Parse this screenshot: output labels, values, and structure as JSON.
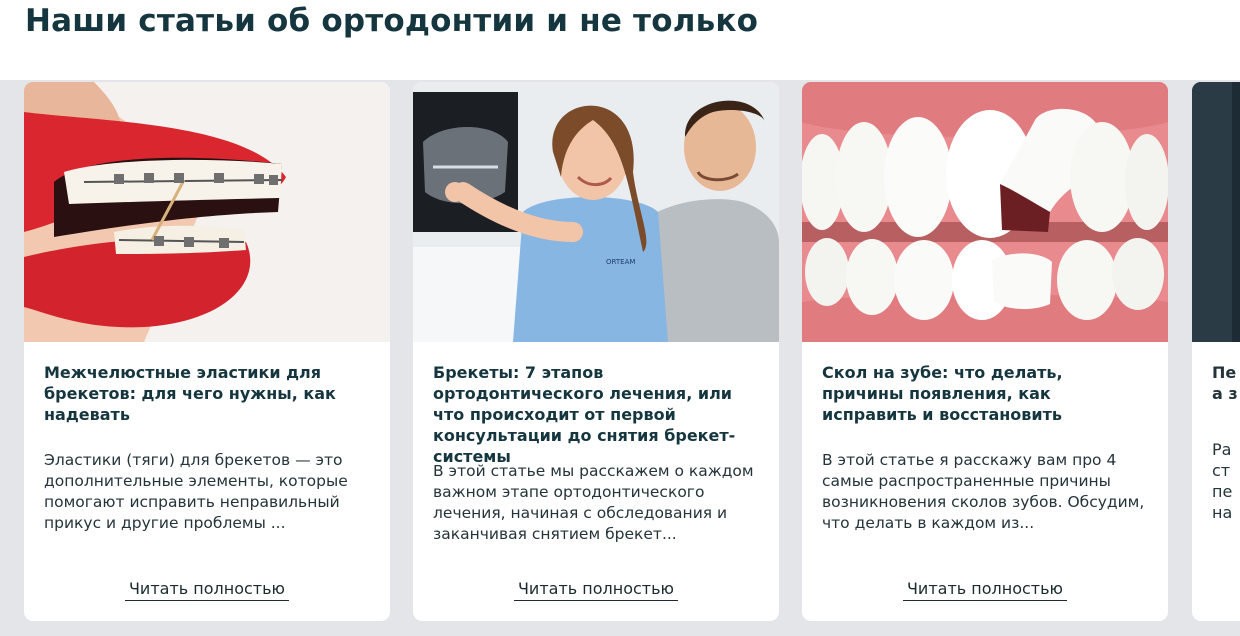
{
  "section": {
    "title": "Наши статьи об ортодонтии и не только"
  },
  "articles": [
    {
      "title": "Межчелюстные эластики для брекетов: для чего нужны, как надевать",
      "excerpt": "Эластики (тяги) для брекетов — это дополнительные элементы, которые помогают исправить неправильный прикус и другие проблемы ...",
      "read_more": "Читать полностью",
      "image": "braces-elastics-mouth"
    },
    {
      "title": "Брекеты: 7 этапов ортодонтического лечения, или что происходит от первой консультации до снятия брекет-системы",
      "excerpt": "В этой статье мы расскажем о каждом важном этапе ортодонтического лечения, начиная с обследования и заканчивая снятием брекет...",
      "read_more": "Читать полностью",
      "image": "doctor-patient-xray",
      "scrub_logo": "ORTEAM"
    },
    {
      "title": "Скол на зубе: что делать, причины появления, как исправить и восстановить",
      "excerpt": "В этой статье я расскажу вам про 4 самые распространенные причины возникновения сколов зубов. Обсудим, что делать в каждом из...",
      "read_more": "Читать полностью",
      "image": "chipped-tooth"
    }
  ],
  "partial_card": {
    "title_lines": [
      "Пе",
      "а з"
    ],
    "excerpt_lines": [
      "Ра",
      "ст",
      "пе",
      "на"
    ]
  }
}
